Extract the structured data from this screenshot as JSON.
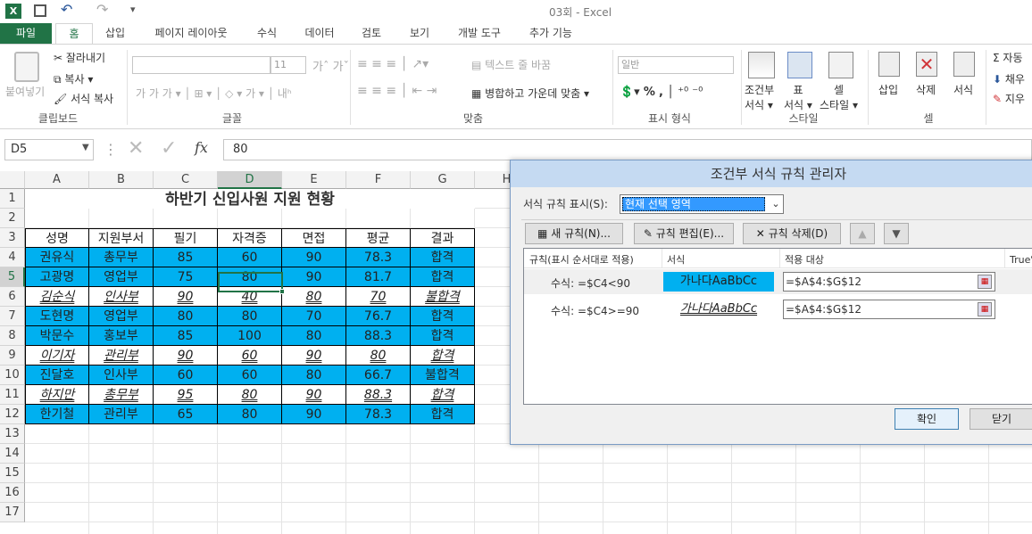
{
  "window": {
    "title": "03회 - Excel"
  },
  "qat": {
    "undo_icon": "undo-icon",
    "redo_icon": "redo-icon"
  },
  "tabs": [
    "파일",
    "홈",
    "삽입",
    "페이지 레이아웃",
    "수식",
    "데이터",
    "검토",
    "보기",
    "개발 도구",
    "추가 기능"
  ],
  "ribbon": {
    "clipboard": {
      "paste": "붙여넣기",
      "cut": "잘라내기",
      "copy": "복사",
      "format_painter": "서식 복사",
      "label": "클립보드"
    },
    "font": {
      "size": "11",
      "label": "글꼴"
    },
    "align": {
      "wrap": "텍스트 줄 바꿈",
      "merge": "병합하고 가운데 맞춤",
      "label": "맞춤"
    },
    "number": {
      "format": "일반",
      "label": "표시 형식"
    },
    "styles": {
      "cond": "조건부",
      "cond2": "서식",
      "table": "표",
      "table2": "서식",
      "cell": "셀",
      "cell2": "스타일",
      "label": "스타일"
    },
    "cells": {
      "insert": "삽입",
      "delete": "삭제",
      "format": "서식",
      "label": "셀"
    },
    "editing": {
      "autosum": "자동",
      "fill": "채우",
      "clear": "지우"
    }
  },
  "formula": {
    "name_box": "D5",
    "value": "80",
    "fx": "fx"
  },
  "sheet": {
    "columns": [
      "A",
      "B",
      "C",
      "D",
      "E",
      "F",
      "G",
      "H"
    ],
    "rows": [
      "1",
      "2",
      "3",
      "4",
      "5",
      "6",
      "7",
      "8",
      "9",
      "10",
      "11",
      "12",
      "13",
      "14",
      "15",
      "16",
      "17"
    ],
    "title": "하반기 신입사원 지원 현황",
    "headers": [
      "성명",
      "지원부서",
      "필기",
      "자격증",
      "면접",
      "평균",
      "결과"
    ],
    "data": [
      [
        "권유식",
        "총무부",
        "85",
        "60",
        "90",
        "78.3",
        "합격"
      ],
      [
        "고광명",
        "영업부",
        "75",
        "80",
        "90",
        "81.7",
        "합격"
      ],
      [
        "김순식",
        "인사부",
        "90",
        "40",
        "80",
        "70",
        "불합격"
      ],
      [
        "도현명",
        "영업부",
        "80",
        "80",
        "70",
        "76.7",
        "합격"
      ],
      [
        "박문수",
        "홍보부",
        "85",
        "100",
        "80",
        "88.3",
        "합격"
      ],
      [
        "이기자",
        "관리부",
        "90",
        "60",
        "90",
        "80",
        "합격"
      ],
      [
        "진달호",
        "인사부",
        "60",
        "60",
        "80",
        "66.7",
        "불합격"
      ],
      [
        "하지만",
        "총무부",
        "95",
        "80",
        "90",
        "88.3",
        "합격"
      ],
      [
        "한기철",
        "관리부",
        "65",
        "80",
        "90",
        "78.3",
        "합격"
      ]
    ]
  },
  "dialog": {
    "title": "조건부 서식 규칙 관리자",
    "show_label": "서식 규칙 표시(S):",
    "show_value": "현재 선택 영역",
    "new_rule": "새 규칙(N)...",
    "edit_rule": "규칙 편집(E)...",
    "delete_rule": "규칙 삭제(D)",
    "col_rule": "규칙(표시 순서대로 적용)",
    "col_format": "서식",
    "col_applies": "적용 대상",
    "col_stop": "True일",
    "rules": [
      {
        "formula": "수식: =$C4<90",
        "preview": "가나다AaBbCc",
        "applies": "=$A$4:$G$12"
      },
      {
        "formula": "수식: =$C4>=90",
        "preview": "가나다AaBbCc",
        "applies": "=$A$4:$G$12"
      }
    ],
    "ok": "확인",
    "close": "닫기"
  },
  "colors": {
    "accent": "#217346",
    "fill_blue": "#00b0f0"
  }
}
